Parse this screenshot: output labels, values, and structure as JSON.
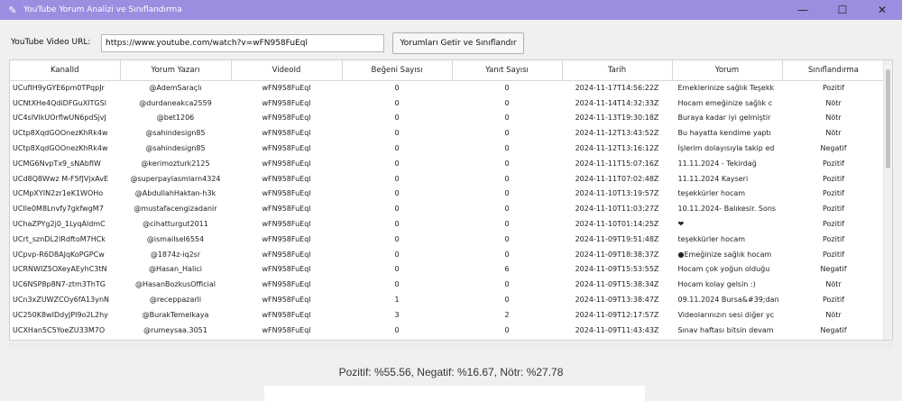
{
  "window": {
    "title": "YouTube Yorum Analizi ve Sınıflandırma",
    "icon": "feather-icon",
    "controls": [
      "—",
      "☐",
      "✕"
    ]
  },
  "toolbar": {
    "url_label": "YouTube Video URL:",
    "url_value": "https://www.youtube.com/watch?v=wFN958FuEql",
    "fetch_button": "Yorumları Getir ve Sınıflandır"
  },
  "table": {
    "columns": [
      "KanalId",
      "Yorum Yazarı",
      "VideoId",
      "Beğeni Sayısı",
      "Yanıt Sayısı",
      "Tarih",
      "Yorum",
      "Sınıflandırma"
    ],
    "rows": [
      [
        "UCufIH9yGYE6pm0TPqpJr",
        "@AdemSaraçlı",
        "wFN958FuEql",
        "0",
        "0",
        "2024-11-17T14:56:22Z",
        "Emeklerinize sağlık Teşekk",
        "Pozitif"
      ],
      [
        "UCNtXHe4QdiDFGuXITGSl",
        "@durdaneakca2559",
        "wFN958FuEql",
        "0",
        "0",
        "2024-11-14T14:32:33Z",
        "Hocam emeğinize sağlık c",
        "Nötr"
      ],
      [
        "UC4sIVlkUOrflwUN6pdSjvJ",
        "@bet1206",
        "wFN958FuEql",
        "0",
        "0",
        "2024-11-13T19:30:18Z",
        "Buraya kadar iyi gelmiştir",
        "Nötr"
      ],
      [
        "UCtp8XqdGOOnezKhRk4w",
        "@sahindesign85",
        "wFN958FuEql",
        "0",
        "0",
        "2024-11-12T13:43:52Z",
        "Bu hayatta kendime yaptı",
        "Nötr"
      ],
      [
        "UCtp8XqdGOOnezKhRk4w",
        "@sahindesign85",
        "wFN958FuEql",
        "0",
        "0",
        "2024-11-12T13:16:12Z",
        "İşlerim dolayısıyla takip ed",
        "Negatif"
      ],
      [
        "UCMG6NvpTx9_sNAbfIW",
        "@kerimozturk2125",
        "wFN958FuEql",
        "0",
        "0",
        "2024-11-11T15:07:16Z",
        "11.11.2024 - Tekirdağ",
        "Pozitif"
      ],
      [
        "UCd8Q8Wwz M-F5fJVjxAvE",
        "@superpaylasmlarn4324",
        "wFN958FuEql",
        "0",
        "0",
        "2024-11-11T07:02:48Z",
        "11.11.2024 Kayseri",
        "Pozitif"
      ],
      [
        "UCMpXYIN2zr1eK1WOHo",
        "@AbdullahHaktan-h3k",
        "wFN958FuEql",
        "0",
        "0",
        "2024-11-10T13:19:57Z",
        "teşekkürler hocam",
        "Pozitif"
      ],
      [
        "UCIle0M8Lnvfy7gkfwgM7",
        "@mustafacengizadanir",
        "wFN958FuEql",
        "0",
        "0",
        "2024-11-10T11:03:27Z",
        "10.11.2024- Balıkesir. Sons",
        "Pozitif"
      ],
      [
        "UChaZPYg2j0_1LyqAldmC",
        "@cihatturgut2011",
        "wFN958FuEql",
        "0",
        "0",
        "2024-11-10T01:14:25Z",
        "❤",
        "Pozitif"
      ],
      [
        "UCrt_sznDL2IRdftoM7HCk",
        "@ismailsel6554",
        "wFN958FuEql",
        "0",
        "0",
        "2024-11-09T19:51:48Z",
        "teşekkürler hocam",
        "Pozitif"
      ],
      [
        "UCpvp-R6D8AJqKoPGPCw",
        "@1874z-iq2sr",
        "wFN958FuEql",
        "0",
        "0",
        "2024-11-09T18:38:37Z",
        "●Emeğinize sağlık hocam",
        "Pozitif"
      ],
      [
        "UCRNWIZ5OXeyAEyhC3tN",
        "@Hasan_Halici",
        "wFN958FuEql",
        "0",
        "6",
        "2024-11-09T15:53:55Z",
        "Hocam çok yoğun olduğu",
        "Negatif"
      ],
      [
        "UC6NSP8p8N7-ztm3ThTG",
        "@HasanBozkusOfficial",
        "wFN958FuEql",
        "0",
        "0",
        "2024-11-09T15:38:34Z",
        "Hocam kolay gelsin :)",
        "Nötr"
      ],
      [
        "UCn3xZUWZCOy6fA13ynN",
        "@receppazarli",
        "wFN958FuEql",
        "1",
        "0",
        "2024-11-09T13:38:47Z",
        "09.11.2024 Bursa&#39;dan",
        "Pozitif"
      ],
      [
        "UC250K8wIDdyJPI9o2L2hy",
        "@BurakTemelkaya",
        "wFN958FuEql",
        "3",
        "2",
        "2024-11-09T12:17:57Z",
        "Videolarınızın sesi diğer yc",
        "Nötr"
      ],
      [
        "UCXHan5C5YoeZU33M7O",
        "@rumeysaa.3051",
        "wFN958FuEql",
        "0",
        "0",
        "2024-11-09T11:43:43Z",
        "Sınav haftası bitsin devam",
        "Negatif"
      ]
    ]
  },
  "summary": "Pozitif: %55.56, Negatif: %16.67, Nötr: %27.78"
}
